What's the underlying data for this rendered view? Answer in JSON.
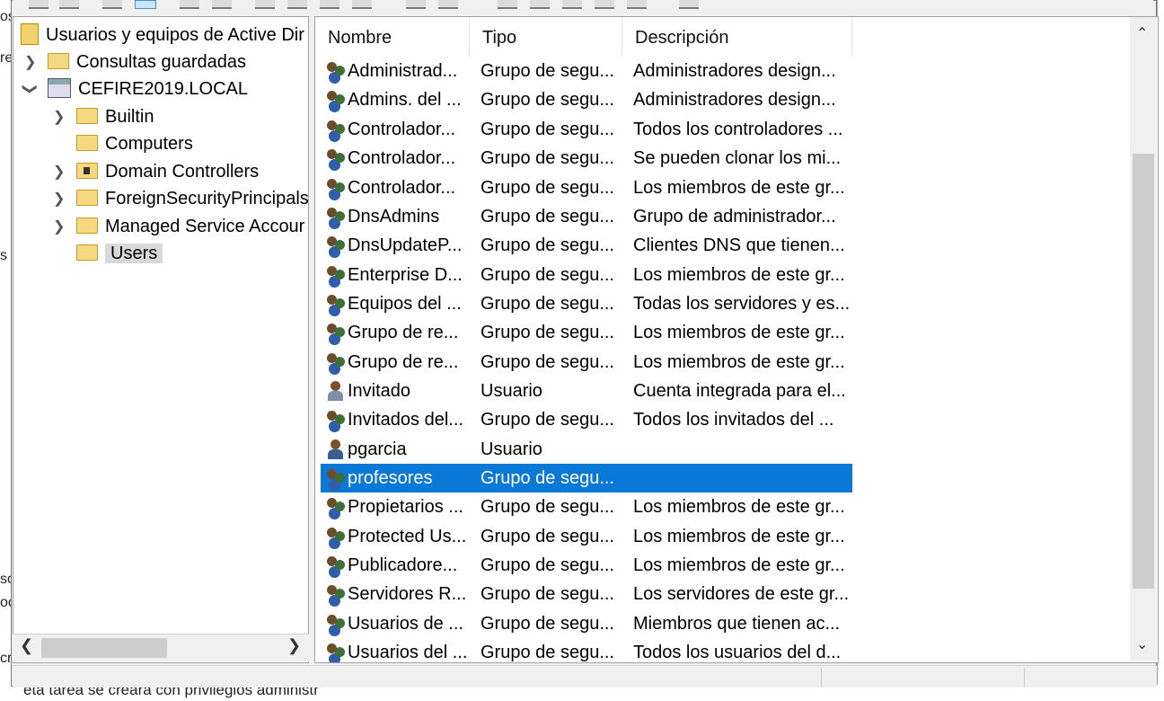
{
  "tree": {
    "root": "Usuarios y equipos de Active Dir",
    "items": [
      {
        "label": "Consultas guardadas"
      },
      {
        "label": "CEFIRE2019.LOCAL"
      },
      {
        "label": "Builtin"
      },
      {
        "label": "Computers"
      },
      {
        "label": "Domain Controllers"
      },
      {
        "label": "ForeignSecurityPrincipals"
      },
      {
        "label": "Managed Service Accour"
      },
      {
        "label": "Users"
      }
    ]
  },
  "columns": {
    "name": "Nombre",
    "type": "Tipo",
    "description": "Descripción"
  },
  "rows": [
    {
      "name": "Administrad...",
      "type": "Grupo de segu...",
      "description": "Administradores design..."
    },
    {
      "name": "Admins. del ...",
      "type": "Grupo de segu...",
      "description": "Administradores design..."
    },
    {
      "name": "Controlador...",
      "type": "Grupo de segu...",
      "description": "Todos los controladores ..."
    },
    {
      "name": "Controlador...",
      "type": "Grupo de segu...",
      "description": "Se pueden clonar los mi..."
    },
    {
      "name": "Controlador...",
      "type": "Grupo de segu...",
      "description": "Los miembros de este gr..."
    },
    {
      "name": "DnsAdmins",
      "type": "Grupo de segu...",
      "description": "Grupo de administrador..."
    },
    {
      "name": "DnsUpdateP...",
      "type": "Grupo de segu...",
      "description": "Clientes DNS que tienen..."
    },
    {
      "name": "Enterprise D...",
      "type": "Grupo de segu...",
      "description": "Los miembros de este gr..."
    },
    {
      "name": "Equipos del ...",
      "type": "Grupo de segu...",
      "description": "Todas los servidores y es..."
    },
    {
      "name": "Grupo de re...",
      "type": "Grupo de segu...",
      "description": "Los miembros de este gr..."
    },
    {
      "name": "Grupo de re...",
      "type": "Grupo de segu...",
      "description": "Los miembros de este gr..."
    },
    {
      "name": "Invitado",
      "type": "Usuario",
      "description": "Cuenta integrada para el..."
    },
    {
      "name": "Invitados del...",
      "type": "Grupo de segu...",
      "description": "Todos los invitados del ..."
    },
    {
      "name": "pgarcia",
      "type": "Usuario",
      "description": ""
    },
    {
      "name": "profesores",
      "type": "Grupo de segu...",
      "description": ""
    },
    {
      "name": "Propietarios ...",
      "type": "Grupo de segu...",
      "description": "Los miembros de este gr..."
    },
    {
      "name": "Protected Us...",
      "type": "Grupo de segu...",
      "description": "Los miembros de este gr..."
    },
    {
      "name": "Publicadore...",
      "type": "Grupo de segu...",
      "description": "Los miembros de este gr..."
    },
    {
      "name": "Servidores R...",
      "type": "Grupo de segu...",
      "description": "Los servidores de este gr..."
    },
    {
      "name": "Usuarios de ...",
      "type": "Grupo de segu...",
      "description": "Miembros que tienen ac..."
    },
    {
      "name": "Usuarios del ...",
      "type": "Grupo de segu...",
      "description": "Todos los usuarios del d..."
    }
  ],
  "selected_row": "profesores",
  "background": {
    "left_fragments": [
      "os",
      "re",
      "s",
      "so",
      "oc",
      "cr"
    ],
    "bottom_text": "eta tarea se creara con privilegios administr"
  },
  "colors": {
    "selection": "#0a78d7",
    "tree_selection": "#d9d9d9"
  }
}
